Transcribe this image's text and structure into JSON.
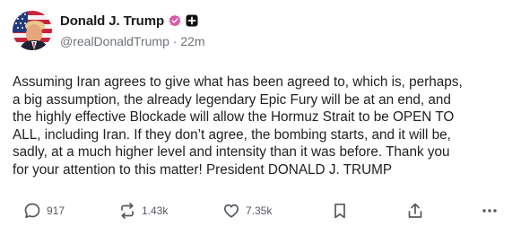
{
  "author": {
    "display_name": "Donald J. Trump",
    "handle": "@realDonaldTrump",
    "separator": "·",
    "time_ago": "22m",
    "verified_color": "#d95aa6"
  },
  "post": {
    "text": "Assuming Iran agrees to give what has been agreed to, which is, perhaps,\na big assumption, the already legendary Epic Fury will be at an end, and\nthe highly effective Blockade will allow the Hormuz Strait to be OPEN TO\nALL, including Iran. If they don’t agree, the bombing starts, and it will be,\nsadly, at a much higher level and intensity than it was before. Thank you\nfor your attention to this matter! President DONALD J. TRUMP"
  },
  "actions": {
    "replies": "917",
    "reposts": "1.43k",
    "likes": "7.35k"
  },
  "icons": {
    "verified": "verified-badge-icon",
    "plus": "plus-icon",
    "reply": "reply-icon",
    "repost": "repost-icon",
    "like": "heart-icon",
    "bookmark": "bookmark-icon",
    "share": "share-icon",
    "more": "more-icon"
  }
}
